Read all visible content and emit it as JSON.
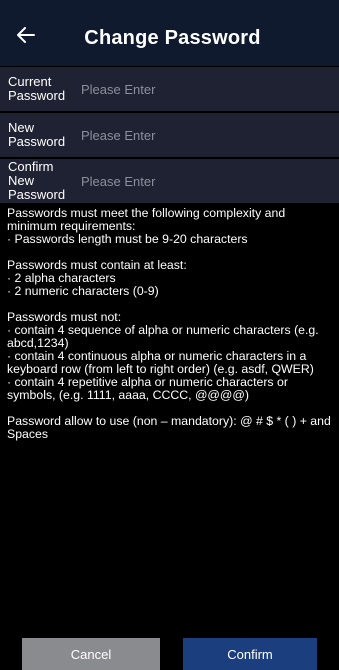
{
  "header": {
    "title": "Change Password",
    "back_icon": "arrow-left-icon"
  },
  "form": {
    "fields": [
      {
        "label": "Current Password",
        "placeholder": "Please Enter",
        "value": ""
      },
      {
        "label": "New Password",
        "placeholder": "Please Enter",
        "value": ""
      },
      {
        "label": "Confirm New Password",
        "placeholder": "Please Enter",
        "value": ""
      }
    ]
  },
  "rules": {
    "intro": [
      "Passwords must meet the following complexity and minimum requirements:",
      "· Passwords length must be 9-20 characters"
    ],
    "must_contain": [
      "Passwords must contain at least:",
      "· 2 alpha characters",
      "· 2 numeric characters (0-9)"
    ],
    "must_not": [
      "Passwords must not:",
      "· contain 4 sequence of alpha or numeric characters (e.g. abcd,1234)",
      "· contain 4 continuous alpha or numeric characters in a keyboard row (from left to right order) (e.g. asdf, QWER)",
      "· contain 4 repetitive alpha or numeric characters or symbols, (e.g. 1111, aaaa, CCCC, @@@@)"
    ],
    "allowed": "Password allow to use (non – mandatory): @ # $ * ( ) + and Spaces"
  },
  "buttons": {
    "cancel": "Cancel",
    "confirm": "Confirm"
  },
  "colors": {
    "background": "#000000",
    "header": "#0f1a2e",
    "field": "#1f2232",
    "placeholder": "#8c8f9c",
    "cancel": "#8a8b8e",
    "confirm": "#1b3f7e"
  }
}
